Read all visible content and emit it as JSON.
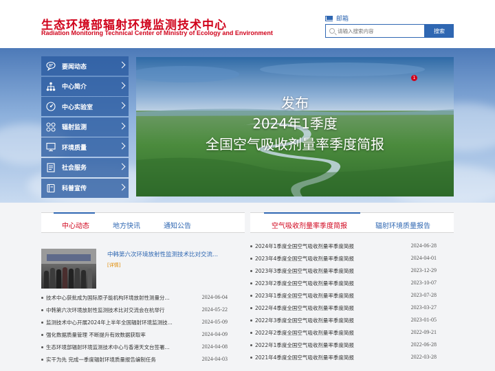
{
  "header": {
    "title_cn": "生态环境部辐射环境监测技术中心",
    "title_en": "Radiation Monitoring Technical Center of Ministry of Ecology and Environment",
    "mail_label": "邮箱",
    "search_placeholder": "请输入搜索内容",
    "search_button": "搜索",
    "accent_color": "#d0021b",
    "brand_blue": "#2f67b2"
  },
  "sidebar": {
    "items": [
      {
        "label": "要闻动态",
        "icon": "chat-bubble-icon"
      },
      {
        "label": "中心简介",
        "icon": "org-chart-icon"
      },
      {
        "label": "中心实验室",
        "icon": "gauge-icon"
      },
      {
        "label": "辐射监测",
        "icon": "grid-circles-icon"
      },
      {
        "label": "环境质量",
        "icon": "monitor-icon"
      },
      {
        "label": "社会服务",
        "icon": "document-icon"
      },
      {
        "label": "科普宣传",
        "icon": "book-icon"
      }
    ]
  },
  "banner": {
    "line1": "发布",
    "line2": "2024年1季度",
    "line3": "全国空气吸收剂量率季度简报",
    "badge": "1"
  },
  "left_panel": {
    "tabs": [
      "中心动态",
      "地方快讯",
      "通知公告"
    ],
    "active_tab": 0,
    "feature": {
      "title": "中韩第六次环境放射性监测技术比对交流...",
      "more": "[详情]"
    },
    "items": [
      {
        "text": "技术中心获批成为国际原子能机构环境放射性测量分...",
        "date": "2024-06-04"
      },
      {
        "text": "中韩第六次环境放射性监测技术比对交流会在杭举行",
        "date": "2024-05-22"
      },
      {
        "text": "监测技术中心开展2024年上半年全国辐射环境监测技...",
        "date": "2024-05-09"
      },
      {
        "text": "强化数据质量管理 不断提升有效数据获取率",
        "date": "2024-04-09"
      },
      {
        "text": "生态环境部辐射环境监测技术中心与香港天文台签署...",
        "date": "2024-04-08"
      },
      {
        "text": "实干为先 完成一季度辐射环境质量报告编制任务",
        "date": "2024-04-03"
      }
    ]
  },
  "right_panel": {
    "tabs": [
      "空气吸收剂量率季度简报",
      "辐射环境质量报告"
    ],
    "active_tab": 0,
    "items": [
      {
        "text": "2024年1季度全国空气吸收剂量率季度简报",
        "date": "2024-06-28"
      },
      {
        "text": "2023年4季度全国空气吸收剂量率季度简报",
        "date": "2024-04-01"
      },
      {
        "text": "2023年3季度全国空气吸收剂量率季度简报",
        "date": "2023-12-29"
      },
      {
        "text": "2023年2季度全国空气吸收剂量率季度简报",
        "date": "2023-10-07"
      },
      {
        "text": "2023年1季度全国空气吸收剂量率季度简报",
        "date": "2023-07-28"
      },
      {
        "text": "2022年4季度全国空气吸收剂量率季度简报",
        "date": "2023-03-27"
      },
      {
        "text": "2022年3季度全国空气吸收剂量率季度简报",
        "date": "2023-01-05"
      },
      {
        "text": "2022年2季度全国空气吸收剂量率季度简报",
        "date": "2022-09-21"
      },
      {
        "text": "2022年1季度全国空气吸收剂量率季度简报",
        "date": "2022-06-28"
      },
      {
        "text": "2021年4季度全国空气吸收剂量率季度简报",
        "date": "2022-03-28"
      }
    ]
  }
}
